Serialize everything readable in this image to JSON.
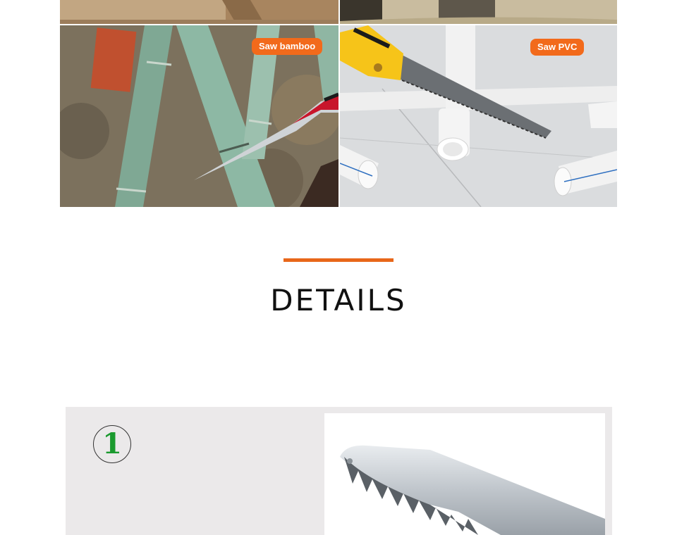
{
  "gallery": {
    "badges": {
      "bamboo": "Saw bamboo",
      "pvc": "Saw PVC"
    },
    "badge_color": "#f26a1b"
  },
  "section": {
    "heading": "DETAILS",
    "accent_color": "#e8671a"
  },
  "detail": {
    "number": "1",
    "number_color": "#1a9a2e"
  }
}
